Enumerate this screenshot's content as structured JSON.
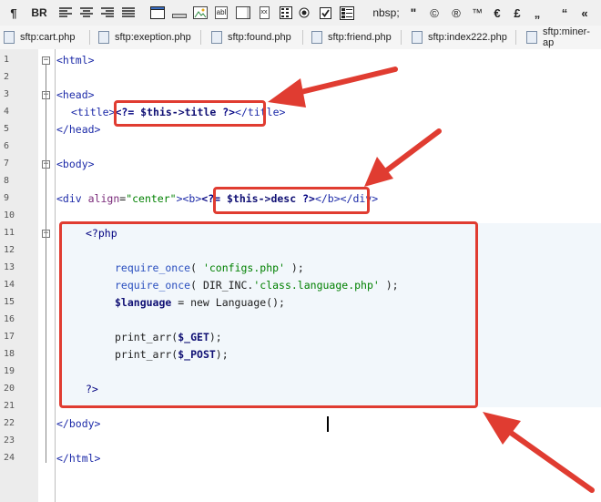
{
  "toolbar": {
    "buttons": [
      {
        "name": "pilcrow-button",
        "label": "¶"
      },
      {
        "name": "br-button",
        "label": "BR"
      },
      {
        "name": "align-left-icon",
        "label": ""
      },
      {
        "name": "align-center-icon",
        "label": ""
      },
      {
        "name": "align-right-icon",
        "label": ""
      },
      {
        "name": "align-justify-icon",
        "label": ""
      },
      {
        "name": "window-icon",
        "label": ""
      },
      {
        "name": "hr-icon",
        "label": ""
      },
      {
        "name": "image-icon",
        "label": ""
      },
      {
        "name": "textfield-icon",
        "label": "abl"
      },
      {
        "name": "textarea-icon",
        "label": "xx"
      },
      {
        "name": "table-icon",
        "label": ""
      },
      {
        "name": "radio-icon",
        "label": ""
      },
      {
        "name": "checkbox-icon",
        "label": ""
      },
      {
        "name": "form-icon",
        "label": ""
      },
      {
        "name": "nbsp-button",
        "label": "nbsp;"
      },
      {
        "name": "quote-button",
        "label": "\""
      },
      {
        "name": "copyright-button",
        "label": "©"
      },
      {
        "name": "registered-button",
        "label": "®"
      },
      {
        "name": "trademark-button",
        "label": "™"
      },
      {
        "name": "euro-button",
        "label": "€"
      },
      {
        "name": "pound-button",
        "label": "£"
      },
      {
        "name": "low-quote-button",
        "label": "„"
      },
      {
        "name": "left-dquote-button",
        "label": "“"
      },
      {
        "name": "guillemet-button",
        "label": "«"
      }
    ]
  },
  "tabs": [
    "sftp:cart.php",
    "sftp:exeption.php",
    "sftp:found.php",
    "sftp:friend.php",
    "sftp:index222.php",
    "sftp:miner-ap"
  ],
  "editor": {
    "line_numbers": [
      "1",
      "2",
      "3",
      "4",
      "5",
      "6",
      "7",
      "8",
      "9",
      "10",
      "11",
      "12",
      "13",
      "14",
      "15",
      "16",
      "17",
      "18",
      "19",
      "20",
      "21",
      "22",
      "23",
      "24"
    ],
    "lines": {
      "l1": "<html>",
      "l3": "<head>",
      "l4_a": "<title>",
      "l4_b": "<?= ",
      "l4_c": "$this->title",
      "l4_d": " ?>",
      "l4_e": "</title>",
      "l5": "</head>",
      "l7": "<body>",
      "l9_a": "<div ",
      "l9_b": "align",
      "l9_c": "=",
      "l9_d": "\"center\"",
      "l9_e": "><b>",
      "l9_f": "<?= ",
      "l9_g": "$this->desc",
      "l9_h": " ?>",
      "l9_i": "</b></div>",
      "l11": "<?php",
      "l13_a": "require_once",
      "l13_b": "( ",
      "l13_c": "'configs.php'",
      "l13_d": " );",
      "l14_a": "require_once",
      "l14_b": "( DIR_INC.",
      "l14_c": "'class.language.php'",
      "l14_d": " );",
      "l15_a": "$language",
      "l15_b": " = new Language();",
      "l17_a": "print_arr(",
      "l17_b": "$_GET",
      "l17_c": ");",
      "l18_a": "print_arr(",
      "l18_b": "$_POST",
      "l18_c": ");",
      "l20": "?>",
      "l22": "</body>",
      "l24": "</html>"
    }
  },
  "colors": {
    "annotation_red": "#e03c31",
    "tag_blue": "#1c2aa8",
    "string_green": "#008000",
    "php_navy": "#000080"
  }
}
